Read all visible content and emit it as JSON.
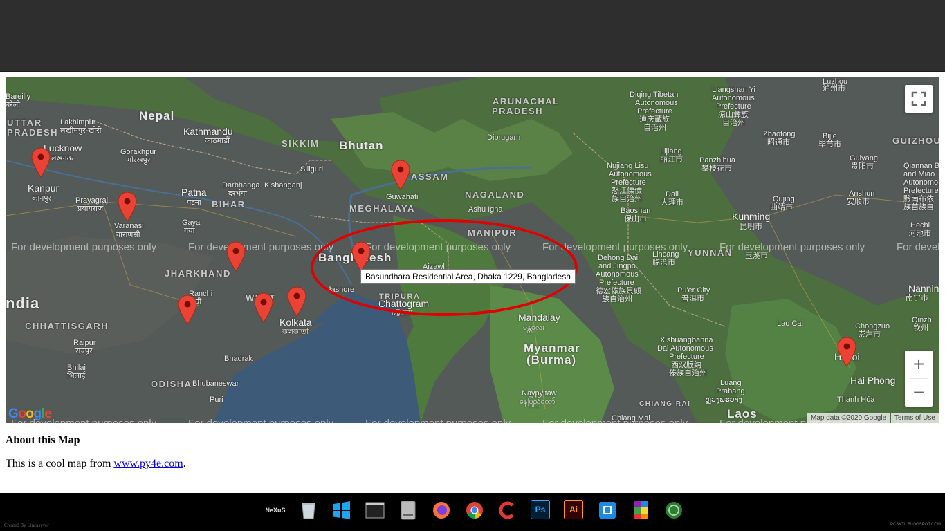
{
  "map": {
    "labels": {
      "nepal": "Nepal",
      "bhutan": "Bhutan",
      "india": "ndia",
      "bangladesh": "Bangladesh",
      "myanmar": "Myanmar",
      "burma": "(Burma)",
      "laos": "Laos",
      "kathmandu": "Kathmandu",
      "kathmandu_local": "काठमाडौं",
      "lucknow": "Lucknow",
      "lucknow_local": "लखनऊ",
      "kanpur": "Kanpur",
      "kanpur_local": "कानपुर",
      "patna": "Patna",
      "patna_local": "पटना",
      "varanasi": "Varanasi",
      "varanasi_local": "वाराणसी",
      "kolkata": "Kolkata",
      "kolkata_local": "কলকাতা",
      "chattogram": "Chattogram",
      "chattogram_local": "চট্টগ্রাম",
      "guwahati": "Guwahati",
      "mandalay": "Mandalay",
      "mandalay_local": "မန္တလေး",
      "kunming": "Kunming",
      "kunming_local": "昆明市",
      "hanoi": "Hanoi",
      "hai_phong": "Hai Phong",
      "bareilly": "Bareilly",
      "bareilly_local": "बरेली",
      "uttar_pradesh": "UTTAR",
      "uttar_pradesh2": "PRADESH",
      "lakhimpur": "Lakhimpur",
      "lakhimpur_local": "लखीमपुर-खीरी",
      "gorakhpur": "Gorakhpur",
      "gorakhpur_local": "गोरखपुर",
      "prayagraj": "Prayagraj",
      "prayagraj_local": "प्रयागराज",
      "darbhanga": "Darbhanga",
      "darbhanga_local": "दरभंगा",
      "kishanganj": "Kishanganj",
      "siliguri": "Siliguri",
      "sikkim": "SIKKIM",
      "bihar": "BIHAR",
      "gaya": "Gaya",
      "gaya_local": "गया",
      "jharkhand": "JHARKHAND",
      "ranchi": "Ranchi",
      "ranchi_local": "रांची",
      "west_bengal": "WEST",
      "chhattisgarh": "CHHATTISGARH",
      "raipur": "Raipur",
      "raipur_local": "रायपुर",
      "bhilai": "Bhilai",
      "bhilai_local": "भिलाई",
      "bhadrak": "Bhadrak",
      "odisha": "ODISHA",
      "bhubaneswar": "Bhubaneswar",
      "puri": "Puri",
      "jessore": "Jashore",
      "tripura": "TRIPURA",
      "aizawl": "Aizawl",
      "meghalaya": "MEGHALAYA",
      "assam": "ASSAM",
      "nagaland": "NAGALAND",
      "manipur": "MANIPUR",
      "arunachal": "ARUNACHAL",
      "arunachal2": "PRADESH",
      "dibrugarh": "Dibrugarh",
      "ashu": "Ashu Igha",
      "diqing": "Diqing Tibetan",
      "diqing2": "Autonomous",
      "diqing3": "Prefecture",
      "diqing4": "迪庆藏族",
      "diqing5": "自治州",
      "liangshan": "Liangshan Yi",
      "liangshan2": "Autonomous",
      "liangshan3": "Prefecture",
      "liangshan4": "凉山彝族",
      "liangshan5": "自治州",
      "luzhou": "Luzhou",
      "luzhou_local": "泸州市",
      "zhaotong": "Zhaotong",
      "zhaotong_local": "昭通市",
      "bijie": "Bijie",
      "bijie_local": "毕节市",
      "guizhou": "GUIZHOU",
      "lijiang": "Lijiang",
      "lijiang_local": "丽江市",
      "panzhihua": "Panzhihua",
      "panzhihua_local": "攀枝花市",
      "guiyang": "Guiyang",
      "guiyang_local": "贵阳市",
      "nujiang": "Nujiang Lisu",
      "nujiang2": "Autonomous",
      "nujiang3": "Prefecture",
      "nujiang4": "怒江傈僳",
      "nujiang5": "族自治州",
      "dali": "Dali",
      "dali_local": "大理市",
      "qujing": "Qujing",
      "qujing_local": "曲靖市",
      "anshun": "Anshun",
      "anshun_local": "安顺市",
      "qiannan": "Qiannan B",
      "qiannan2": "and Miao",
      "qiannan3": "Autonomo",
      "qiannan4": "Prefecture",
      "qiannan5": "黔南布依",
      "qiannan6": "族苗族自",
      "baoshan": "Baoshan",
      "baoshan_local": "保山市",
      "hechi": "Hechi",
      "hechi_local": "河池市",
      "yunnan": "YUNNAN",
      "yuxi_local": "玉溪市",
      "lincang": "Lincang",
      "lincang_local": "临沧市",
      "dehong": "Dehong Dai",
      "dehong2": "and Jingpo",
      "dehong3": "Autonomous",
      "dehong4": "Prefecture",
      "dehong5": "德宏傣族景颇",
      "dehong6": "族自治州",
      "puer": "Pu'er City",
      "puer_local": "普洱市",
      "nanning": "Nannin",
      "nanning_local": "南宁市",
      "qinzhou": "Qinzh",
      "qinzhou_local": "钦州",
      "chongzuo": "Chongzuo",
      "chongzuo_local": "崇左市",
      "lao_cai": "Lao Cai",
      "xishuang": "Xishuangbanna",
      "xishuang2": "Dai Autonomous",
      "xishuang3": "Prefecture",
      "xishuang4": "西双版纳",
      "xishuang5": "傣族自治州",
      "luang": "Luang",
      "luang2": "Prabang",
      "luang3": "ຫຼວງພະບາງ",
      "chiang_rai": "CHIANG RAI",
      "chiang_mai": "Chiang Mai",
      "thanh_hoa": "Thanh Hóa",
      "naypyitaw": "Naypyitaw",
      "naypyitaw_local": "နေပြည်တော်"
    },
    "watermark": "For development purposes only",
    "tooltip": "Basundhara Residential Area, Dhaka 1229, Bangladesh",
    "logo": "Google",
    "attribution": "Map data ©2020 Google",
    "terms": "Terms of Use",
    "zoom_in": "+",
    "zoom_out": "−"
  },
  "about": {
    "heading": "About this Map",
    "text_before": "This is a cool map from ",
    "link": "www.py4e.com",
    "text_after": "."
  },
  "taskbar": {
    "apps": [
      "nexus-dock-icon",
      "recycle-bin-icon",
      "windows-icon",
      "terminal-icon",
      "drive-icon",
      "firefox-icon",
      "chrome-icon",
      "ccleaner-icon",
      "photoshop-icon",
      "illustrator-icon",
      "app-icon",
      "winrar-icon",
      "android-icon"
    ],
    "nexus_label": "NeXuS",
    "ps_label": "Ps",
    "ai_label": "Ai",
    "credit_left": "Created By Lincasyver",
    "credit_right": "PCSKTL.BLOGSPOT.COM"
  },
  "colors": {
    "marker": "#ea4335",
    "circle": "#e00000",
    "water": "#3d5a78",
    "land_green": "#4f7a3e",
    "land_gray": "#5b5f5c"
  }
}
